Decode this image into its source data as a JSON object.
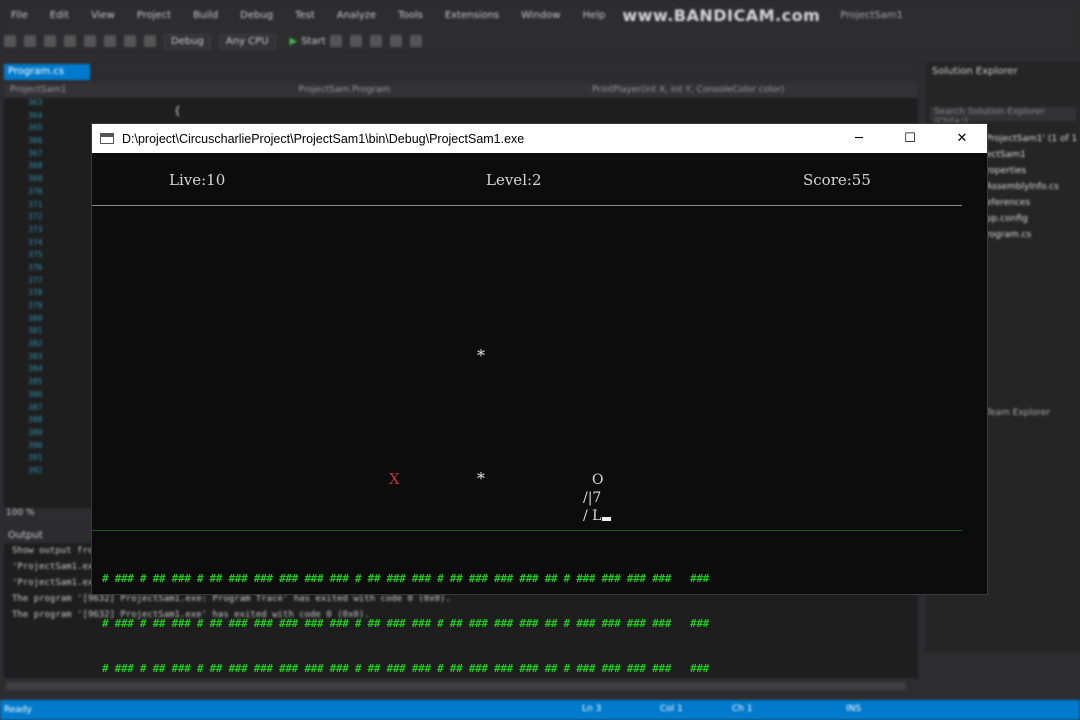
{
  "vs": {
    "menu": [
      "File",
      "Edit",
      "View",
      "Project",
      "Build",
      "Debug",
      "Test",
      "Analyze",
      "Tools",
      "Extensions",
      "Window",
      "Help"
    ],
    "watermark": "www.BANDICAM.com",
    "project_title": "ProjectSam1",
    "toolbar": {
      "config": "Debug",
      "platform": "Any CPU",
      "start": "Start"
    },
    "tab": "Program.cs",
    "nav": {
      "project": "ProjectSam1",
      "class": "ProjectSam.Program",
      "member": "PrintPlayer(int X, int Y, ConsoleColor color)"
    },
    "line_numbers": [
      "363",
      "364",
      "365",
      "366",
      "367",
      "368",
      "369",
      "370",
      "371",
      "372",
      "373",
      "374",
      "375",
      "376",
      "377",
      "378",
      "379",
      "380",
      "381",
      "382",
      "383",
      "384",
      "385",
      "386",
      "387",
      "388",
      "389",
      "390",
      "391",
      "392"
    ],
    "solution": {
      "title": "Solution Explorer",
      "search": "Search Solution Explorer (Ctrl+;)",
      "items": [
        "ProjectSam1' (1 of 1",
        "ectSam1",
        "roperties",
        "AssemblyInfo.cs",
        "eferences",
        "pp.config",
        "rogram.cs"
      ],
      "bottom_tab": "Team Explorer"
    },
    "output": {
      "title": "Output",
      "show_from": "Show output from:",
      "lines": [
        "'ProjectSam1.exe'",
        "'ProjectSam1.exe'",
        "The program '[9632] ProjectSam1.exe: Program Trace' has exited with code 0 (0x0).",
        "The program '[9632] ProjectSam1.exe' has exited with code 0 (0x0)."
      ]
    },
    "zoom": "100 %",
    "status": {
      "ready": "Ready",
      "ln": "Ln 3",
      "col": "Col 1",
      "ch": "Ch 1",
      "ins": "INS"
    }
  },
  "console": {
    "title": "D:\\project\\CircuscharlieProject\\ProjectSam1\\bin\\Debug\\ProjectSam1.exe",
    "controls": {
      "minimize": "─",
      "maximize": "☐",
      "close": "✕"
    },
    "hud": {
      "lives": "Live:10",
      "level": "Level:2",
      "score": "Score:55"
    },
    "stars": [
      "*",
      "*"
    ],
    "enemy": "X",
    "player": {
      "head": "O",
      "body": "/|7",
      "legs": "/ L"
    },
    "ground_rows": [
      "# ### # ## ### # ## ### ### ### ### ### # ## ### ### # ## ### ### ### ## # ### ### ### ###   ###",
      "# ### # ## ### # ## ### ### ### ### ### # ## ### ### # ## ### ### ### ## # ### ### ### ###   ###",
      "# ### # ## ### # ## ### ### ### ### ### # ## ### ### # ## ### ### ### ## # ### ### ### ###   ###"
    ]
  },
  "colors": {
    "vs_bg": "#2d2d30",
    "vs_accent": "#007acc",
    "console_bg": "#0c0c0c",
    "ground": "#1fc41f",
    "enemy": "#c0343e"
  }
}
